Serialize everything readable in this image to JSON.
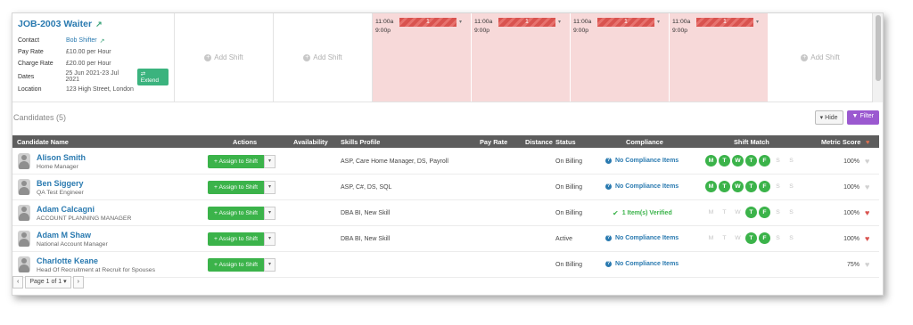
{
  "job": {
    "title": "JOB-2003 Waiter",
    "contact_label": "Contact",
    "contact": "Bob Shifter",
    "pay_rate_label": "Pay Rate",
    "pay_rate": "£10.00 per Hour",
    "charge_rate_label": "Charge Rate",
    "charge_rate": "£20.00 per Hour",
    "dates_label": "Dates",
    "dates": "25 Jun 2021-23 Jul 2021",
    "extend_label": "Extend",
    "location_label": "Location",
    "location": "123 High Street, London"
  },
  "add_shift_label": "Add Shift",
  "shifts": [
    {
      "start": "11:00a",
      "end": "9:00p",
      "count": "1"
    },
    {
      "start": "11:00a",
      "end": "9:00p",
      "count": "1"
    },
    {
      "start": "11:00a",
      "end": "9:00p",
      "count": "1"
    },
    {
      "start": "11:00a",
      "end": "9:00p",
      "count": "1"
    }
  ],
  "candidates_title": "Candidates (5)",
  "hide_label": "Hide",
  "filter_label": "Filter",
  "columns": {
    "name": "Candidate Name",
    "actions": "Actions",
    "availability": "Availability",
    "skills": "Skills Profile",
    "pay_rate": "Pay Rate",
    "distance": "Distance",
    "status": "Status",
    "compliance": "Compliance",
    "shift_match": "Shift Match",
    "metric_score": "Metric Score"
  },
  "assign_label": "Assign to Shift",
  "candidates": [
    {
      "name": "Alison Smith",
      "role": "Home Manager",
      "skills": "ASP, Care Home Manager, DS, Payroll",
      "status": "On Billing",
      "compliance": "No Compliance Items",
      "score": "100%"
    },
    {
      "name": "Ben Siggery",
      "role": "QA Test Engineer",
      "skills": "ASP, C#, DS, SQL",
      "status": "On Billing",
      "compliance": "No Compliance Items",
      "score": "100%"
    },
    {
      "name": "Adam Calcagni",
      "role": "ACCOUNT PLANNING MANAGER",
      "skills": "DBA BI, New Skill",
      "status": "On Billing",
      "compliance": "1 Item(s) Verified",
      "score": "100%"
    },
    {
      "name": "Adam M Shaw",
      "role": "National Account Manager",
      "skills": "DBA BI, New Skill",
      "status": "Active",
      "compliance": "No Compliance Items",
      "score": "100%"
    },
    {
      "name": "Charlotte Keane",
      "role": "Head Of Recruitment at Recruit for Spouses",
      "skills": "",
      "status": "On Billing",
      "compliance": "No Compliance Items",
      "score": "75%"
    }
  ],
  "day_letters": [
    "M",
    "T",
    "W",
    "T",
    "F",
    "S",
    "S"
  ],
  "pager_label": "Page 1 of 1"
}
